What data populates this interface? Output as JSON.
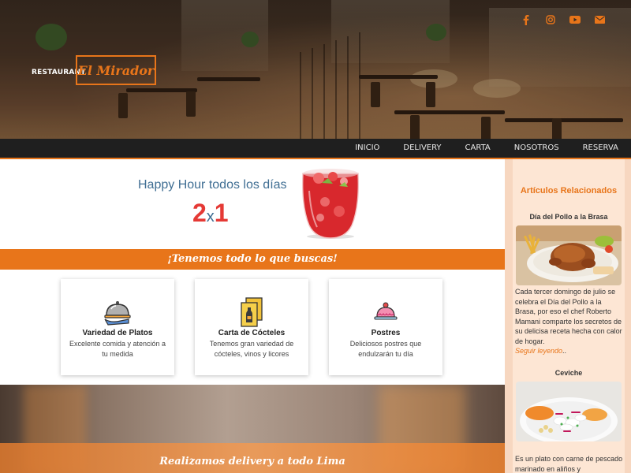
{
  "brand": {
    "tagline": "RESTAURANT",
    "name": "El Mirador"
  },
  "social": [
    "facebook-icon",
    "instagram-icon",
    "youtube-icon",
    "mail-icon"
  ],
  "nav": {
    "items": [
      "INICIO",
      "DELIVERY",
      "CARTA",
      "NOSOTROS",
      "RESERVA"
    ]
  },
  "promo": {
    "headline": "Happy Hour todos los días",
    "offer_a": "2",
    "offer_x": "x",
    "offer_b": "1"
  },
  "band": {
    "text": "¡Tenemos todo lo que buscas!"
  },
  "cards": [
    {
      "title": "Variedad de Platos",
      "text": "Excelente comida y atención a tu medida"
    },
    {
      "title": "Carta de Cócteles",
      "text": "Tenemos gran variedad de cócteles, vinos y licores"
    },
    {
      "title": "Postres",
      "text": "Deliciosos postres que endulzarán tu día"
    }
  ],
  "delivery": {
    "text": "Realizamos delivery a todo Lima"
  },
  "sidebar": {
    "heading": "Artículos Relacionados",
    "articles": [
      {
        "title": "Día del Pollo a la Brasa",
        "text": "Cada tercer domingo de julio se celebra el Día del Pollo a la Brasa, por eso el chef Roberto Mamani comparte los secretos de su delicisa receta hecha con calor de hogar.",
        "link": "Seguir leyendo",
        "link_suffix": ".."
      },
      {
        "title": "Ceviche",
        "text": "Es un plato con carne de pescado marinado en aliños y"
      }
    ]
  },
  "colors": {
    "accent": "#e8751a",
    "nav_bg": "#1f1f1f",
    "promo_blue": "#3f6e93",
    "promo_red": "#e53935",
    "sidebar_bg": "#fde6d4"
  }
}
